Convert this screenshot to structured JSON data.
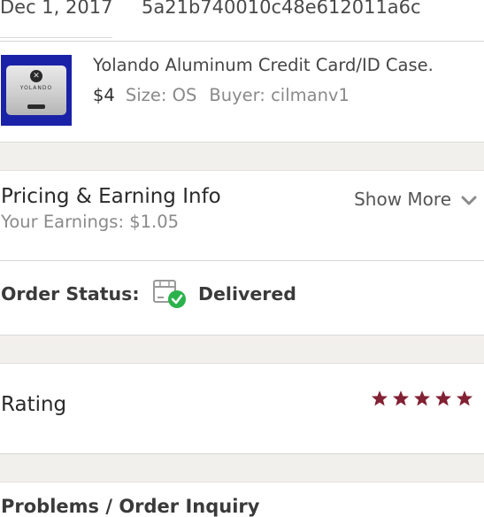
{
  "order": {
    "date": "Dec 1, 2017",
    "order_id": "5a21b740010c48e612011a6c"
  },
  "item": {
    "title": "Yolando Aluminum Credit Card/ID Case.",
    "price": "$4",
    "size": "Size: OS",
    "buyer": "Buyer: cilmanv1",
    "thumbnail_icon": "product-thumbnail",
    "thumbnail_logo_text": "YOLANDO"
  },
  "pricing": {
    "heading": "Pricing & Earning Info",
    "earnings": "Your Earnings: $1.05",
    "show_more": "Show More"
  },
  "status": {
    "label": "Order Status:",
    "value": "Delivered",
    "icon": "package-delivered-icon",
    "check_color": "#2bb24c"
  },
  "rating": {
    "label": "Rating",
    "stars": 5,
    "max_stars": 5,
    "star_color": "#822133"
  },
  "problems": {
    "label": "Problems / Order Inquiry"
  },
  "colors": {
    "section_gap": "#f2f0ed",
    "divider": "#d8d8d8"
  }
}
